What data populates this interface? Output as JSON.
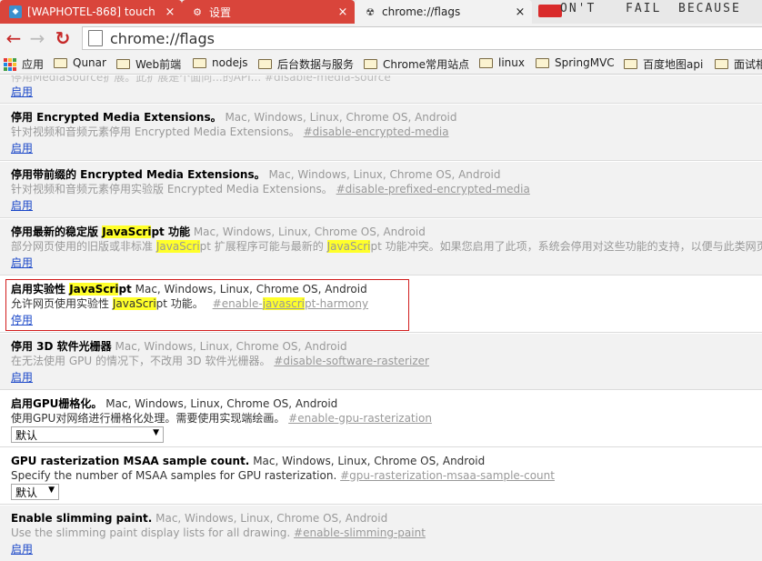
{
  "tabs": [
    {
      "title": "[WAPHOTEL-868] touch",
      "close": "×",
      "icon": "jira-icon"
    },
    {
      "title": "设置",
      "close": "×",
      "icon": "settings-gear-icon"
    },
    {
      "title": "chrome://flags",
      "close": "×",
      "icon": "flask-icon"
    }
  ],
  "brand": {
    "w1": "ON'T",
    "w2": "FAIL",
    "w3": "BECAUSE"
  },
  "nav": {
    "back": "←",
    "forward": "→",
    "reload": "↻"
  },
  "omnibox": {
    "url": "chrome://flags"
  },
  "bookmarks": [
    {
      "label": "应用",
      "icon": "apps-icon"
    },
    {
      "label": "Qunar",
      "icon": "folder-icon"
    },
    {
      "label": "Web前端",
      "icon": "folder-icon"
    },
    {
      "label": "nodejs",
      "icon": "folder-icon"
    },
    {
      "label": "后台数据与服务",
      "icon": "folder-icon"
    },
    {
      "label": "Chrome常用站点",
      "icon": "folder-icon"
    },
    {
      "label": "linux",
      "icon": "folder-icon"
    },
    {
      "label": "SpringMVC",
      "icon": "folder-icon"
    },
    {
      "label": "百度地图api",
      "icon": "folder-icon"
    },
    {
      "label": "面试相",
      "icon": "folder-icon"
    }
  ],
  "experiments": [
    {
      "cutoff_desc": "停用MediaSource扩展。此扩展是个面向...的API... #disable-media-source",
      "action": "启用"
    },
    {
      "name": "停用 Encrypted Media Extensions。",
      "platforms": "Mac, Windows, Linux, Chrome OS, Android",
      "desc": "针对视频和音频元素停用 Encrypted Media Extensions。",
      "anchor": "#disable-encrypted-media",
      "action": "启用"
    },
    {
      "name": "停用带前缀的 Encrypted Media Extensions。",
      "platforms": "Mac, Windows, Linux, Chrome OS, Android",
      "desc": "针对视频和音频元素停用实验版 Encrypted Media Extensions。",
      "anchor": "#disable-prefixed-encrypted-media",
      "action": "启用"
    },
    {
      "name_pre": "停用最新的稳定版 ",
      "name_hl": "JavaScri",
      "name_post": "pt 功能",
      "platforms": "Mac, Windows, Linux, Chrome OS, Android",
      "desc_a": "部分网页使用的旧版或非标准 ",
      "desc_hl1": "JavaScri",
      "desc_b": "pt 扩展程序可能与最新的 ",
      "desc_hl2": "JavaScri",
      "desc_c": "pt 功能冲突。如果您启用了此项，系统会停用对这些功能的支持，以便与此类网页兼",
      "action": "启用"
    },
    {
      "name_pre": "启用实验性 ",
      "name_hl": "JavaScri",
      "name_post": "pt",
      "platforms": "Mac, Windows, Linux, Chrome OS, Android",
      "desc_a": "允许网页使用实验性 ",
      "desc_hl": "JavaScri",
      "desc_b": "pt 功能。",
      "anchor_a": "#enable-",
      "anchor_hl": "javascri",
      "anchor_b": "pt-harmony",
      "action": "停用"
    },
    {
      "name": "停用 3D 软件光栅器",
      "platforms": "Mac, Windows, Linux, Chrome OS, Android",
      "desc": "在无法使用 GPU 的情况下，不改用 3D 软件光栅器。",
      "anchor": "#disable-software-rasterizer",
      "action": "启用"
    },
    {
      "name": "启用GPU栅格化。",
      "platforms": "Mac, Windows, Linux, Chrome OS, Android",
      "desc": "使用GPU对网络进行栅格化处理。需要使用实现端绘画。",
      "anchor": "#enable-gpu-rasterization",
      "select": "默认",
      "arrow": "▼"
    },
    {
      "name": "GPU rasterization MSAA sample count.",
      "platforms": "Mac, Windows, Linux, Chrome OS, Android",
      "desc": "Specify the number of MSAA samples for GPU rasterization.",
      "anchor": "#gpu-rasterization-msaa-sample-count",
      "select": "默认",
      "arrow": "▼"
    },
    {
      "name": "Enable slimming paint.",
      "platforms": "Mac, Windows, Linux, Chrome OS, Android",
      "desc": "Use the slimming paint display lists for all drawing.",
      "anchor": "#enable-slimming-paint",
      "action": "启用"
    }
  ],
  "colors": {
    "highlight": "#ffff2a",
    "link": "#1a47c8",
    "active_tab_red": "#d9453b",
    "focus_box": "#d21d1d"
  }
}
